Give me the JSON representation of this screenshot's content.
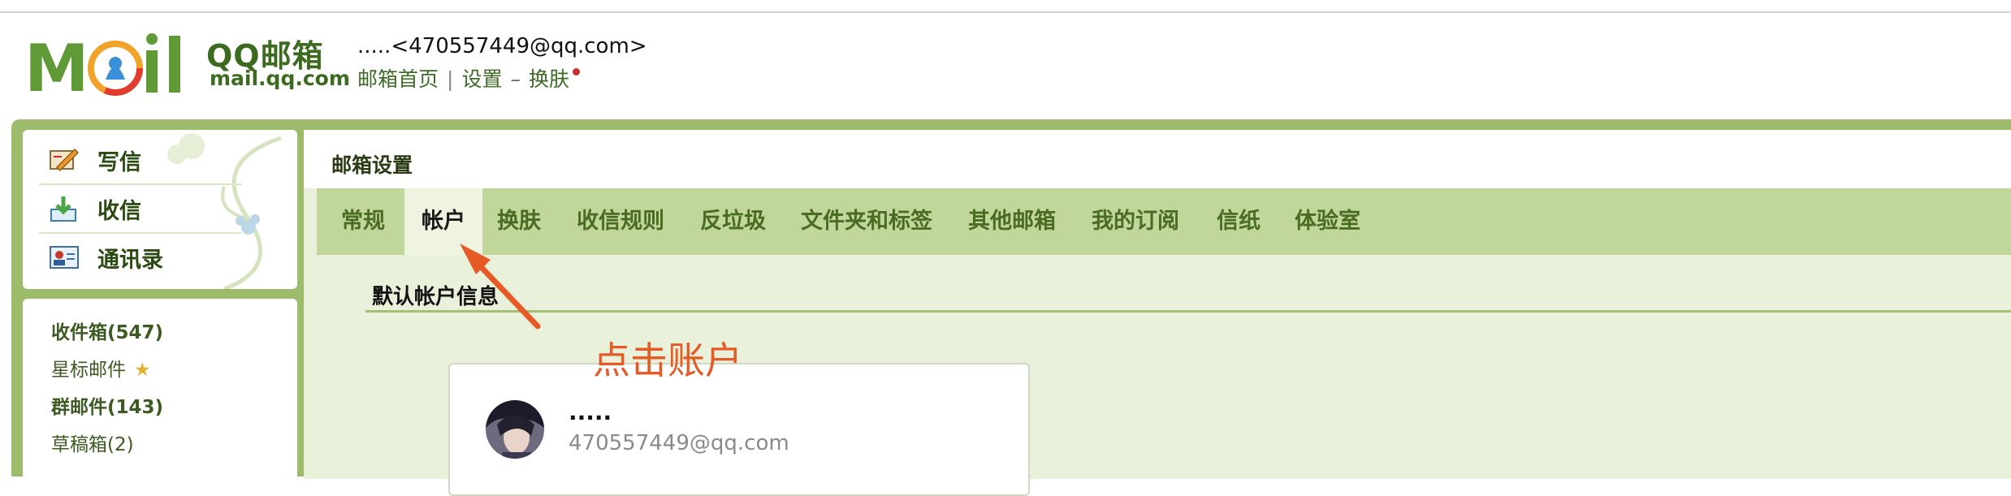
{
  "header": {
    "logo_brand": "MOil",
    "logo_product": "QQ邮箱",
    "logo_domain": "mail.qq.com",
    "account": ".....<470557449@qq.com>",
    "links": {
      "home": "邮箱首页",
      "separator": "|",
      "settings": "设置",
      "dash": "–",
      "skin": "换肤"
    }
  },
  "sidebar": {
    "actions": [
      {
        "label": "写信",
        "icon": "compose-icon"
      },
      {
        "label": "收信",
        "icon": "inbox-download-icon"
      },
      {
        "label": "通讯录",
        "icon": "contacts-icon"
      }
    ],
    "folders": [
      {
        "label": "收件箱(547)",
        "bold": true
      },
      {
        "label": "星标邮件",
        "bold": false,
        "icon": "star-icon"
      },
      {
        "label": "群邮件(143)",
        "bold": true
      },
      {
        "label": "草稿箱(2)",
        "bold": false
      }
    ]
  },
  "settings": {
    "title": "邮箱设置",
    "tabs": [
      {
        "label": "常规"
      },
      {
        "label": "帐户",
        "active": true
      },
      {
        "label": "换肤"
      },
      {
        "label": "收信规则"
      },
      {
        "label": "反垃圾"
      },
      {
        "label": "文件夹和标签"
      },
      {
        "label": "其他邮箱"
      },
      {
        "label": "我的订阅"
      },
      {
        "label": "信纸"
      },
      {
        "label": "体验室"
      }
    ],
    "section_title": "默认帐户信息",
    "annotation": "点击账户",
    "card": {
      "name": ".....",
      "email": "470557449@qq.com"
    }
  },
  "colors": {
    "frame_green": "#9cbc6c",
    "tab_bar": "#c1d69a",
    "panel_bg": "#eaf1da",
    "annotation_red": "#e55a25",
    "link_green": "#3d6b26"
  }
}
